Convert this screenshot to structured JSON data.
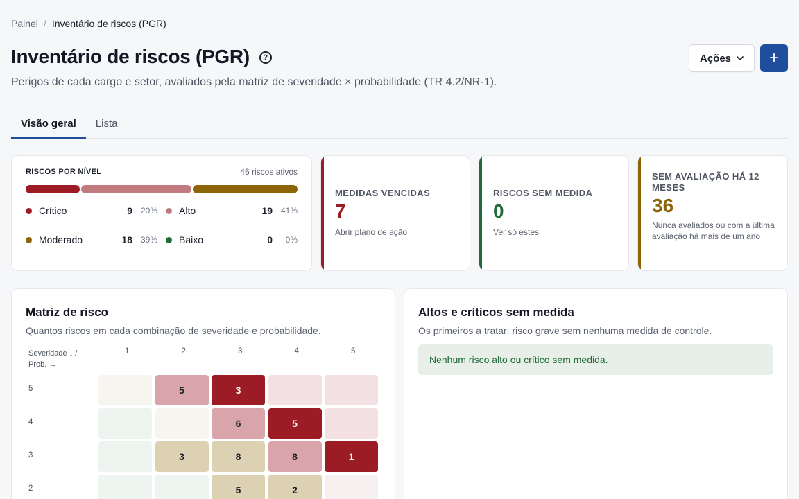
{
  "breadcrumb": {
    "root": "Painel",
    "separator": "/",
    "current": "Inventário de riscos (PGR)"
  },
  "header": {
    "title": "Inventário de riscos (PGR)",
    "help_glyph": "?",
    "subtitle": "Perigos de cada cargo e setor, avaliados pela matriz de severidade × probabilidade (TR 4.2/NR-1).",
    "actions_label": "Ações",
    "add_glyph": "+"
  },
  "tabs": [
    {
      "label": "Visão geral",
      "active": true
    },
    {
      "label": "Lista",
      "active": false
    }
  ],
  "levels": {
    "title": "RISCOS POR NÍVEL",
    "total": "46 riscos ativos",
    "items": [
      {
        "name": "Crítico",
        "count": "9",
        "pct": "20%",
        "color": "#9b1c24",
        "share": 0.2
      },
      {
        "name": "Alto",
        "count": "19",
        "pct": "41%",
        "color": "#c07a80",
        "share": 0.41
      },
      {
        "name": "Moderado",
        "count": "18",
        "pct": "39%",
        "color": "#8b6508",
        "share": 0.39
      },
      {
        "name": "Baixo",
        "count": "0",
        "pct": "0%",
        "color": "#1f6b3b",
        "share": 0
      }
    ]
  },
  "stats": [
    {
      "label": "MEDIDAS VENCIDAS",
      "value": "7",
      "desc": "Abrir plano de ação",
      "color": "#9b1c24"
    },
    {
      "label": "RISCOS SEM MEDIDA",
      "value": "0",
      "desc": "Ver só estes",
      "color": "#1f6b3b"
    },
    {
      "label": "SEM AVALIAÇÃO HÁ 12 MESES",
      "value": "36",
      "desc": "Nunca avaliados ou com a última avaliação há mais de um ano",
      "color": "#8b6508"
    }
  ],
  "matrix": {
    "title": "Matriz de risco",
    "subtitle": "Quantos riscos em cada combinação de severidade e probabilidade.",
    "axis_label_line1": "Severidade ↓ /",
    "axis_label_line2": "Prob. →",
    "columns": [
      "1",
      "2",
      "3",
      "4",
      "5"
    ],
    "rows": [
      {
        "label": "5",
        "cells": [
          {
            "value": "",
            "color": "#f7f5f0",
            "text_color": "#1b1f2a"
          },
          {
            "value": "5",
            "color": "#d9a5aa",
            "text_color": "#1b1f2a"
          },
          {
            "value": "3",
            "color": "#9b1c24",
            "text_color": "#ffffff"
          },
          {
            "value": "",
            "color": "#f3e0e2",
            "text_color": "#1b1f2a"
          },
          {
            "value": "",
            "color": "#f3e0e2",
            "text_color": "#1b1f2a"
          }
        ]
      },
      {
        "label": "4",
        "cells": [
          {
            "value": "",
            "color": "#eef4ef",
            "text_color": "#1b1f2a"
          },
          {
            "value": "",
            "color": "#f7f5f0",
            "text_color": "#1b1f2a"
          },
          {
            "value": "6",
            "color": "#d9a5aa",
            "text_color": "#1b1f2a"
          },
          {
            "value": "5",
            "color": "#9b1c24",
            "text_color": "#ffffff"
          },
          {
            "value": "",
            "color": "#f3e0e2",
            "text_color": "#1b1f2a"
          }
        ]
      },
      {
        "label": "3",
        "cells": [
          {
            "value": "",
            "color": "#eef4ef",
            "text_color": "#1b1f2a"
          },
          {
            "value": "3",
            "color": "#ddd1b3",
            "text_color": "#1b1f2a"
          },
          {
            "value": "8",
            "color": "#ddd1b3",
            "text_color": "#1b1f2a"
          },
          {
            "value": "8",
            "color": "#d9a5aa",
            "text_color": "#1b1f2a"
          },
          {
            "value": "1",
            "color": "#9b1c24",
            "text_color": "#ffffff"
          }
        ]
      },
      {
        "label": "2",
        "cells": [
          {
            "value": "",
            "color": "#eef4ef",
            "text_color": "#1b1f2a"
          },
          {
            "value": "",
            "color": "#eef4ef",
            "text_color": "#1b1f2a"
          },
          {
            "value": "5",
            "color": "#ddd1b3",
            "text_color": "#1b1f2a"
          },
          {
            "value": "2",
            "color": "#ddd1b3",
            "text_color": "#1b1f2a"
          },
          {
            "value": "",
            "color": "#f7f0f0",
            "text_color": "#1b1f2a"
          }
        ]
      }
    ]
  },
  "alerts": {
    "title": "Altos e críticos sem medida",
    "subtitle": "Os primeiros a tratar: risco grave sem nenhuma medida de controle.",
    "empty_message": "Nenhum risco alto ou crítico sem medida."
  }
}
